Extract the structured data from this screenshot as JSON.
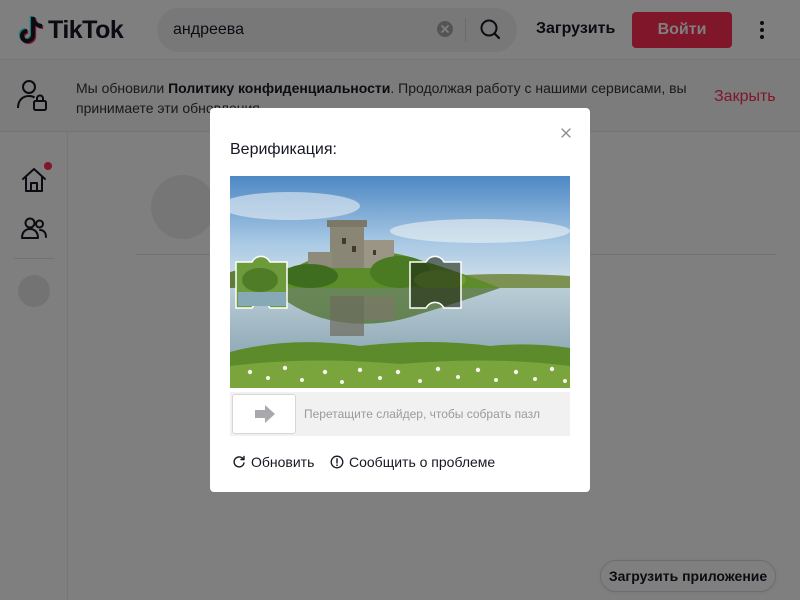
{
  "header": {
    "logo_text": "TikTok",
    "search_value": "андреева",
    "upload_label": "Загрузить",
    "login_label": "Войти"
  },
  "banner": {
    "text_before": "Мы обновили ",
    "text_bold": "Политику конфиденциальности",
    "text_after": ". Продолжая работу с нашими сервисами, вы принимаете эти обновления.",
    "close_label": "Закрыть"
  },
  "modal": {
    "title": "Верификация:",
    "slider_hint": "Перетащите слайдер, чтобы собрать пазл",
    "refresh_label": "Обновить",
    "report_label": "Сообщить о проблеме"
  },
  "footer": {
    "download_app_label": "Загрузить приложение"
  },
  "colors": {
    "brand": "#fe2c55",
    "text": "#161823",
    "muted": "#9a9aa0"
  },
  "icons": [
    "tiktok-logo-icon",
    "search-icon",
    "clear-icon",
    "more-vertical-icon",
    "user-lock-icon",
    "home-icon",
    "friends-icon",
    "close-icon",
    "arrow-right-icon",
    "refresh-icon",
    "info-icon"
  ]
}
